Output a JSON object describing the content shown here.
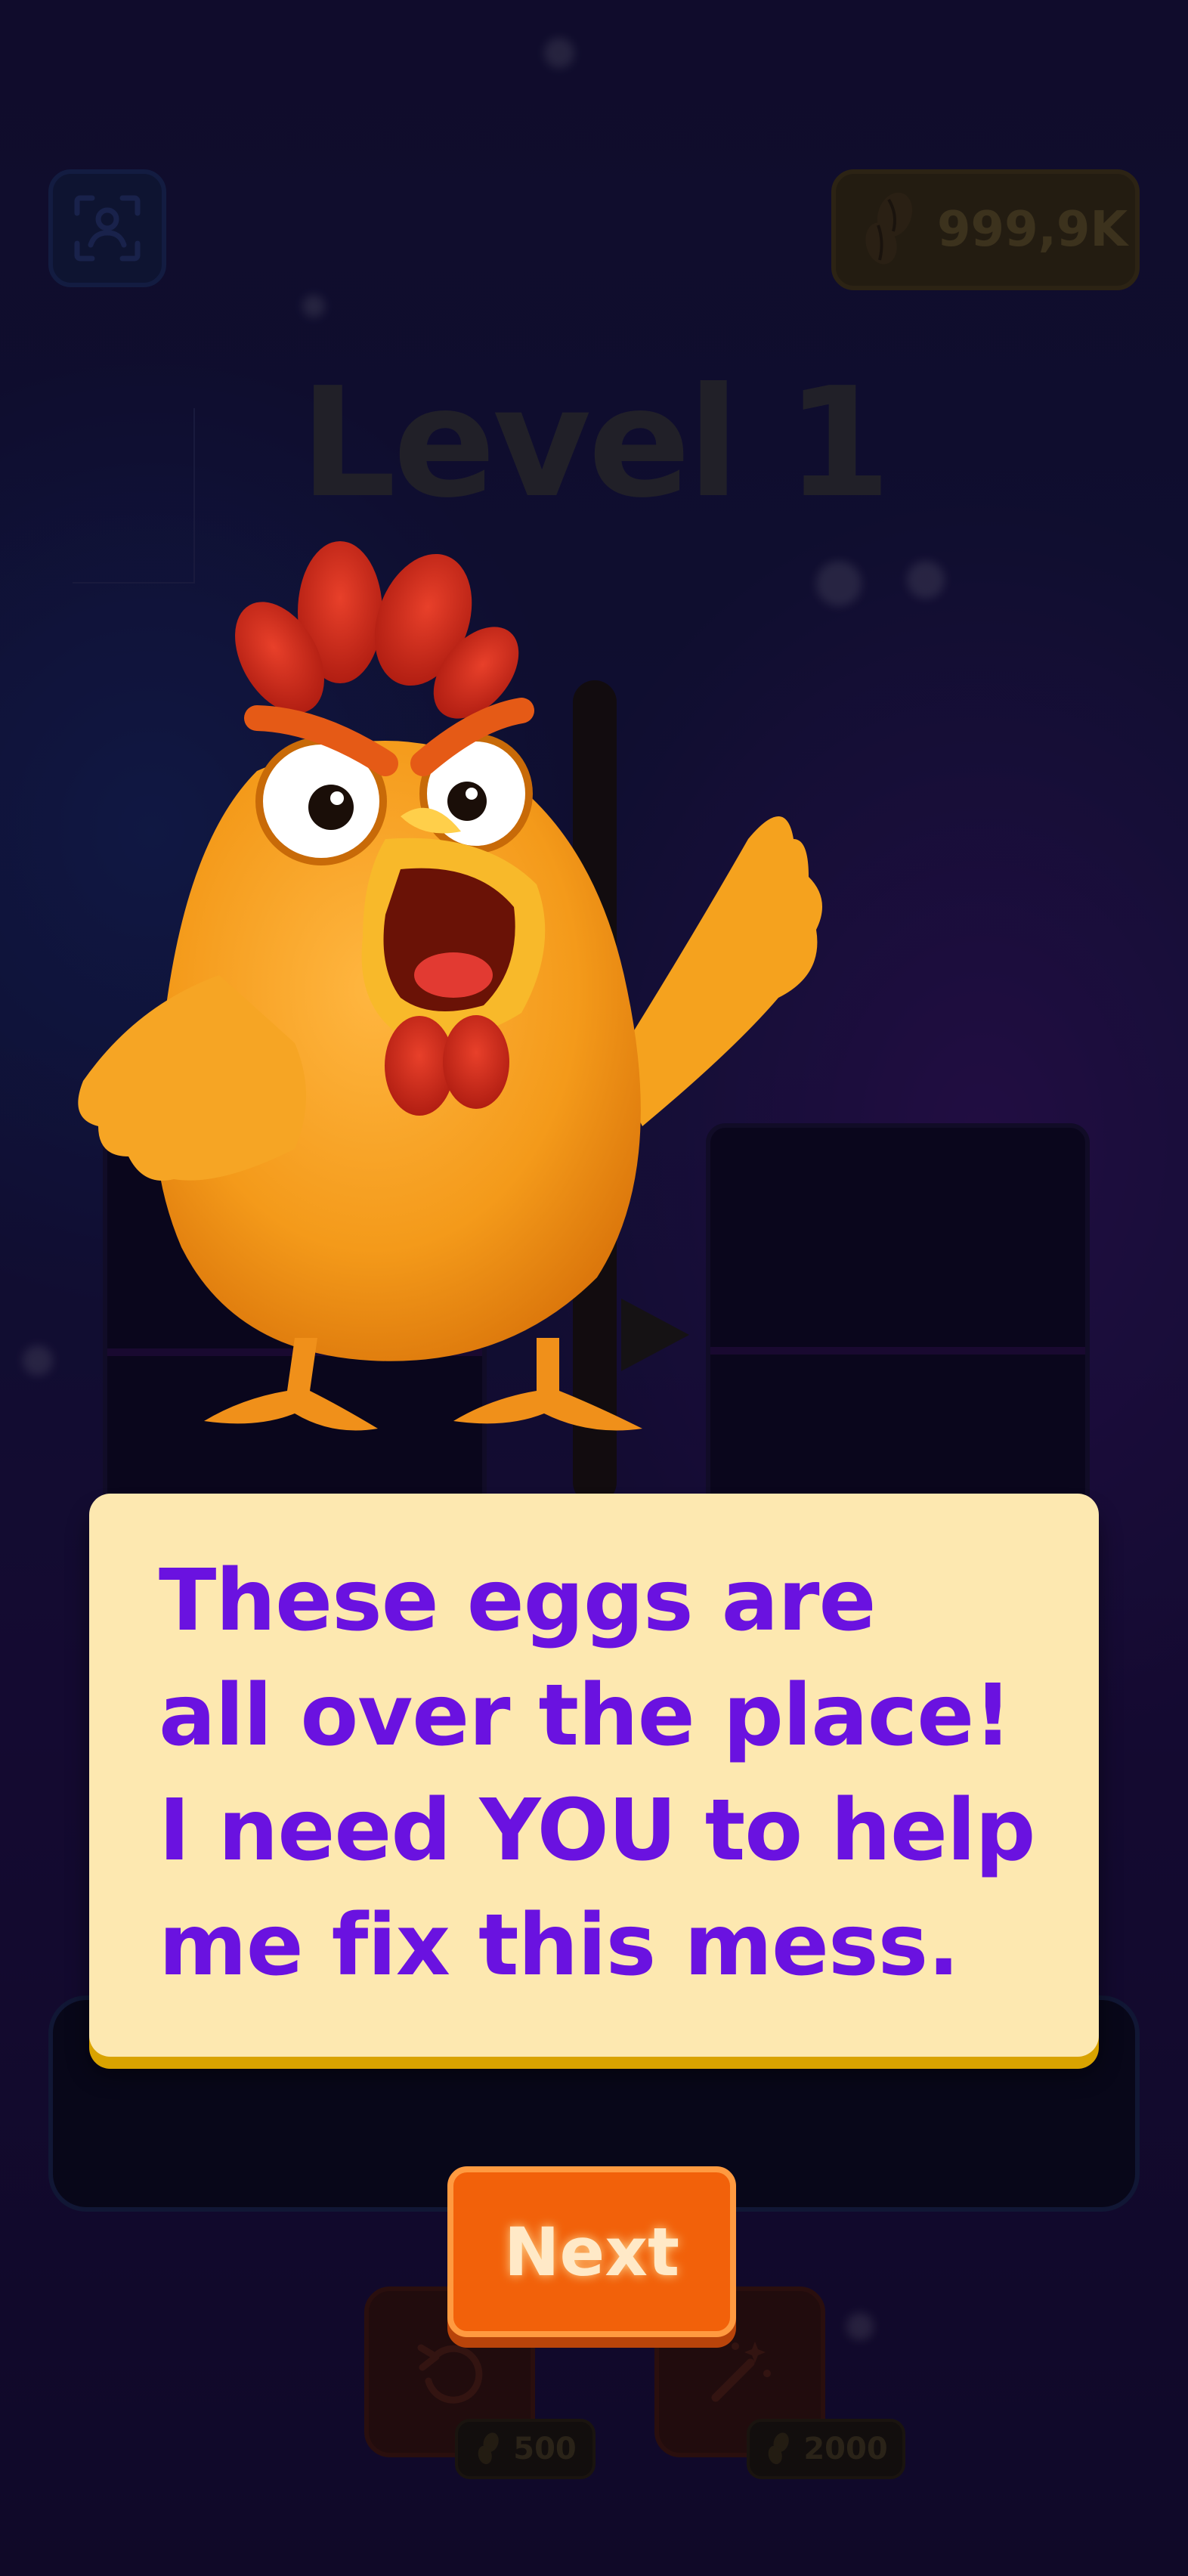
{
  "header": {
    "coins": "999,9K",
    "level_title": "Level 1"
  },
  "icons": {
    "profile": "profile-scan-icon",
    "coin": "seed-coins-icon",
    "undo": "undo-icon",
    "magic": "magic-wand-icon"
  },
  "tools": {
    "undo_price": "500",
    "magic_price": "2000"
  },
  "dialog": {
    "lines": [
      "These eggs are",
      "all over the place!",
      "I need YOU to help",
      "me fix this mess."
    ],
    "next_label": "Next"
  },
  "colors": {
    "dialog_bg": "#fde8b0",
    "dialog_text": "#6a12e0",
    "next_button": "#f2610a",
    "next_text": "#ffe9c7"
  }
}
